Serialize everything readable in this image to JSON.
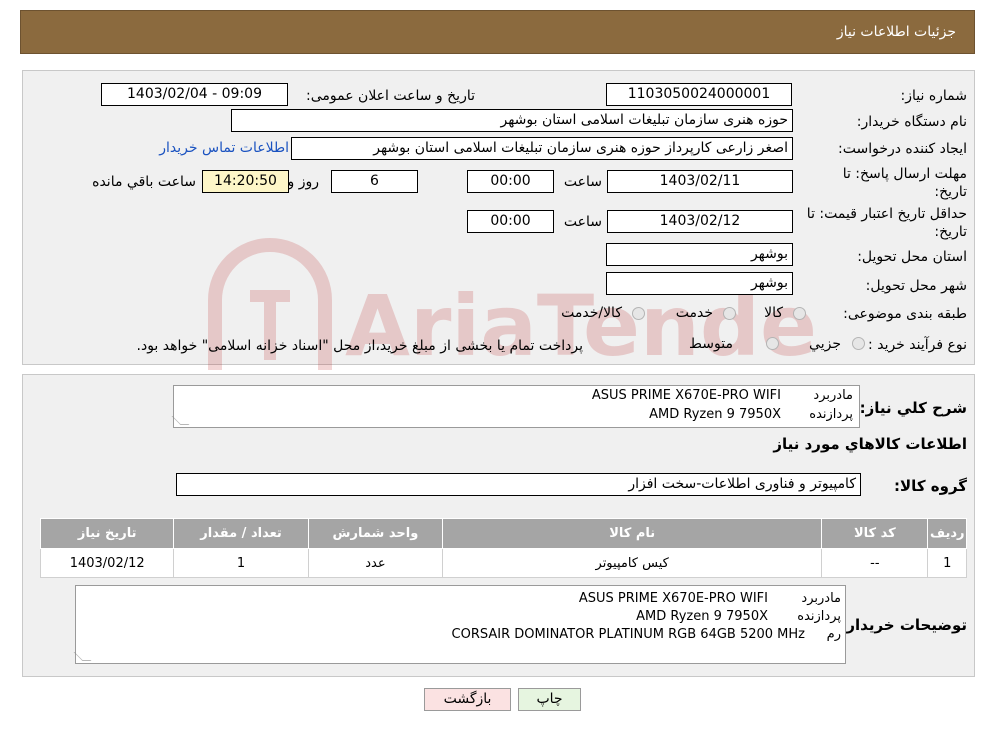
{
  "header": {
    "title": "جزئیات اطلاعات نیاز"
  },
  "form": {
    "need_number_label": "شماره نیاز:",
    "need_number": "1103050024000001",
    "announce_label": "تاریخ و ساعت اعلان عمومی:",
    "announce_value": "1403/02/04 - 09:09",
    "buyer_org_label": "نام دستگاه خریدار:",
    "buyer_org": "حوزه هنری سازمان تبلیغات اسلامی استان بوشهر",
    "requester_label": "ایجاد کننده درخواست:",
    "requester": "اصغر زارعی کارپرداز حوزه هنری سازمان تبلیغات اسلامی استان بوشهر",
    "contact_link": "اطلاعات تماس خریدار",
    "deadline_label_1": "مهلت ارسال پاسخ: تا",
    "deadline_label_2": "تاریخ:",
    "deadline_date": "1403/02/11",
    "time_label": "ساعت",
    "deadline_time": "00:00",
    "days_value": "6",
    "days_label": "روز و",
    "remaining_time": "14:20:50",
    "remaining_label": "ساعت باقي مانده",
    "validity_label_1": "حداقل تاریخ اعتبار قیمت: تا",
    "validity_label_2": "تاریخ:",
    "validity_date": "1403/02/12",
    "validity_time": "00:00",
    "province_label": "استان محل تحویل:",
    "province": "بوشهر",
    "city_label": "شهر محل تحویل:",
    "city": "بوشهر",
    "category_label": "طبقه بندی موضوعی:",
    "category_options": [
      "کالا",
      "خدمت",
      "کالا/خدمت"
    ],
    "process_label": "نوع فرآیند خرید :",
    "process_options": [
      "جزیي",
      "متوسط"
    ],
    "process_note": "پرداخت تمام یا بخشی از مبلغ خرید،از محل \"اسناد خزانه اسلامی\" خواهد بود."
  },
  "summary": {
    "label": "شرح کلي نياز:",
    "lines": [
      {
        "key": "مادربرد",
        "value": "ASUS PRIME X670E-PRO WIFI"
      },
      {
        "key": "پردازنده",
        "value": "AMD Ryzen 9 7950X"
      }
    ]
  },
  "goods": {
    "section_title": "اطلاعات کالاهاي مورد نياز",
    "group_label": "گروه کالا:",
    "group_value": "کامپیوتر و فناوری اطلاعات-سخت افزار",
    "table": {
      "headers": [
        "رديف",
        "کد کالا",
        "نام کالا",
        "واحد شمارش",
        "تعداد / مقدار",
        "تاريخ نياز"
      ],
      "rows": [
        [
          "1",
          "--",
          "کیس کامپیوتر",
          "عدد",
          "1",
          "1403/02/12"
        ]
      ]
    }
  },
  "buyer_notes": {
    "label": "توضیحات خریدار:",
    "lines": [
      {
        "key": "مادربرد",
        "value": "ASUS PRIME X670E-PRO WIFI"
      },
      {
        "key": "پردازنده",
        "value": "AMD Ryzen 9 7950X"
      },
      {
        "key": "رم",
        "value": "CORSAIR DOMINATOR PLATINUM RGB 64GB 5200 MHz"
      }
    ]
  },
  "buttons": {
    "print": "چاپ",
    "back": "بازگشت"
  },
  "watermark": {
    "text": "AriaTender.neT"
  }
}
